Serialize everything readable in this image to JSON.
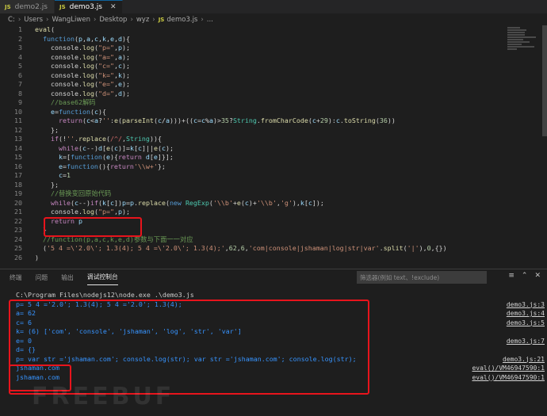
{
  "tabs": [
    {
      "label": "demo2.js",
      "badge": "JS",
      "active": false
    },
    {
      "label": "demo3.js",
      "badge": "JS",
      "active": true
    }
  ],
  "breadcrumb": {
    "parts": [
      "C:",
      "Users",
      "WangLiwen",
      "Desktop",
      "wyz"
    ],
    "file_badge": "JS",
    "file": "demo3.js",
    "tail": "..."
  },
  "editor": {
    "line_numbers": [
      "1",
      "2",
      "3",
      "4",
      "5",
      "6",
      "7",
      "8",
      "9",
      "10",
      "11",
      "12",
      "13",
      "14",
      "15",
      "16",
      "17",
      "18",
      "19",
      "20",
      "21",
      "22",
      "23",
      "24",
      "25",
      "26"
    ],
    "lines": [
      "eval(",
      "  function(p,a,c,k,e,d){",
      "    console.log(\"p=\",p);",
      "    console.log(\"a=\",a);",
      "    console.log(\"c=\",c);",
      "    console.log(\"k=\",k);",
      "    console.log(\"e=\",e);",
      "    console.log(\"d=\",d);",
      "    //base62解码",
      "    e=function(c){",
      "      return(c<a?'':e(parseInt(c/a)))+((c=c%a)>35?String.fromCharCode(c+29):c.toString(36))",
      "    };",
      "    if(!''.replace(/^/,String)){",
      "      while(c--)d[e(c)]=k[c]||e(c);",
      "      k=[function(e){return d[e]}];",
      "      e=function(){return'\\\\w+'};",
      "      c=1",
      "    };",
      "    //替换变回原始代码",
      "    while(c--)if(k[c])p=p.replace(new RegExp('\\\\b'+e(c)+'\\\\b','g'),k[c]);",
      "    console.log(\"p=\",p);",
      "    return p",
      "  }",
      "  //function(p,a,c,k,e,d)参数与下面一一对应",
      "  ('5 4 =\\'2.0\\'; 1.3(4); 5 4 =\\'2.0\\'; 1.3(4);',62,6,'com|console|jshaman|log|str|var'.split('|'),0,{})",
      ")"
    ]
  },
  "panel": {
    "tabs": [
      "终端",
      "问题",
      "输出",
      "调试控制台"
    ],
    "active_tab": "调试控制台",
    "filter_placeholder": "筛选器(例如 text、!exclude)",
    "command": "C:\\Program Files\\nodejs12\\node.exe .\\demo3.js",
    "output": [
      {
        "text": "p= 5 4 ='2.0'; 1.3(4); 5 4 ='2.0'; 1.3(4);",
        "source": "demo3.js:3",
        "expandable": false
      },
      {
        "text": "a= 62",
        "source": "demo3.js:4",
        "expandable": false
      },
      {
        "text": "c= 6",
        "source": "demo3.js:5",
        "expandable": false
      },
      {
        "text": "k= (6) ['com', 'console', 'jshaman', 'log', 'str', 'var']",
        "source": "",
        "expandable": true
      },
      {
        "text": "e= 0",
        "source": "demo3.js:7",
        "expandable": false
      },
      {
        "text": "d= {}",
        "source": "",
        "expandable": true
      },
      {
        "text": "p= var str ='jshaman.com'; console.log(str); var str ='jshaman.com'; console.log(str);",
        "source": "demo3.js:21",
        "expandable": false
      },
      {
        "text": "jshaman.com",
        "source": "eval()/VM46947590:1",
        "expandable": false
      },
      {
        "text": "jshaman.com",
        "source": "eval()/VM46947590:1",
        "expandable": false
      }
    ]
  },
  "watermark": "FREEBUF",
  "colors": {
    "annotation_box": "#e8141c",
    "editor_bg": "#1e1e1e",
    "output_text": "#3794ff"
  }
}
